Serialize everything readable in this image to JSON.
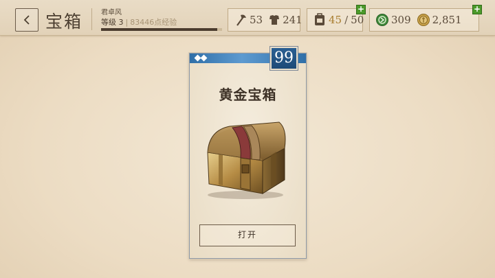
{
  "header": {
    "title": "宝箱",
    "user_name": "君卓风",
    "level_label": "等级 3",
    "xp_text": "83446点经验",
    "xp_progress": 0.96
  },
  "stats": {
    "attack": "53",
    "defense": "241",
    "capacity_current": "45",
    "capacity_max": "50",
    "silver": "309",
    "gold": "2,851"
  },
  "chest_card": {
    "count": "99",
    "name": "黄金宝箱",
    "open_label": "打开"
  },
  "colors": {
    "badge_blue": "#2a5f92",
    "plus_green": "#4c9a2a",
    "gold_text": "#a87d2f"
  },
  "icons": [
    "chevron-left-icon",
    "axe-icon",
    "armor-icon",
    "backpack-icon",
    "plus-icon",
    "silver-coin-icon",
    "gold-coin-icon",
    "gem-icon"
  ]
}
